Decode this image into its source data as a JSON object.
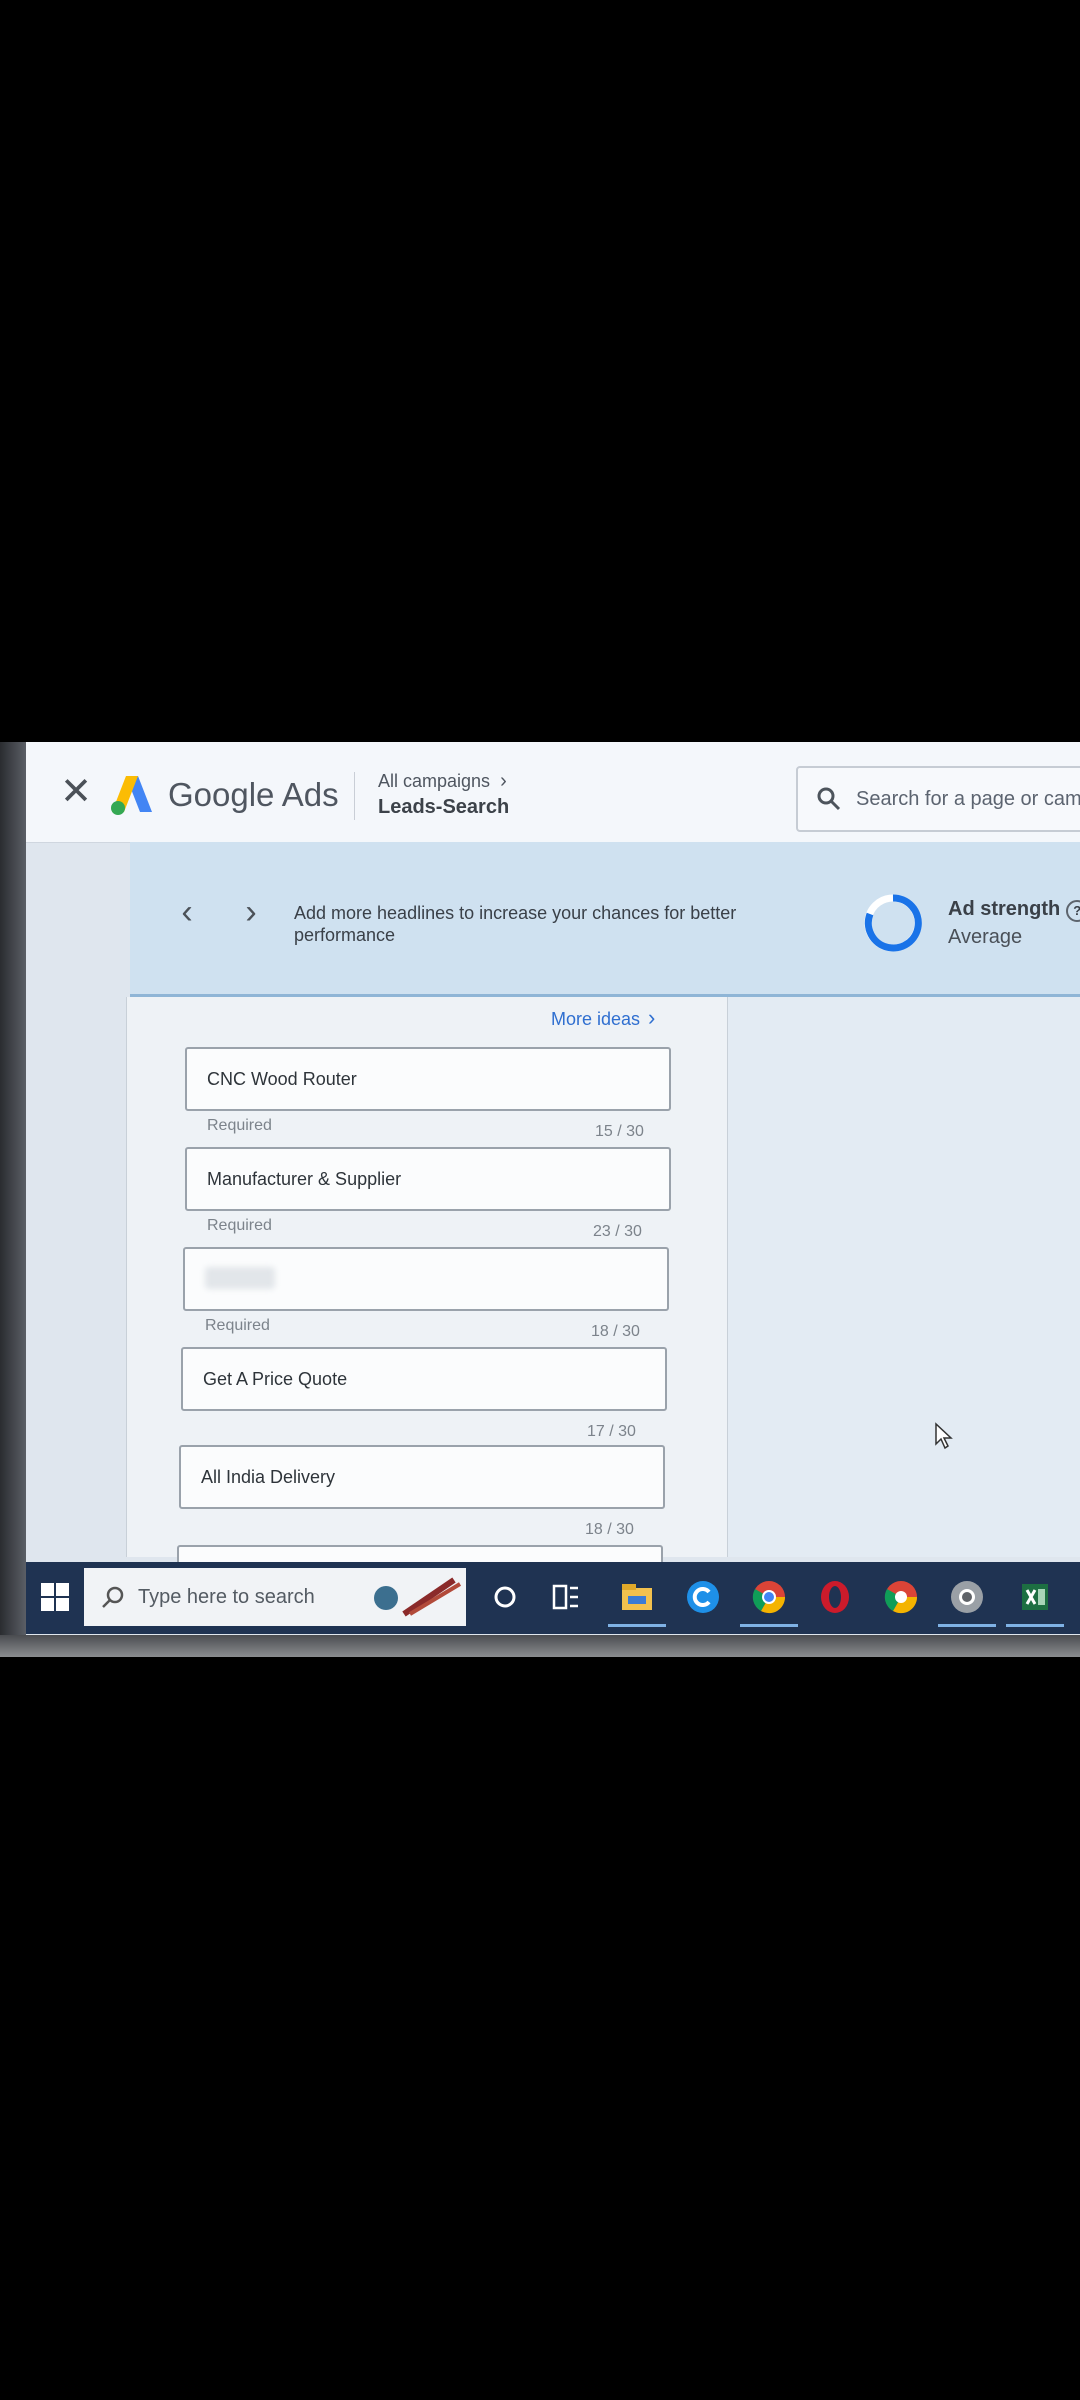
{
  "header": {
    "close_icon": "close-icon",
    "brand": "Google Ads",
    "breadcrumb_top": "All campaigns",
    "breadcrumb_main": "Leads-Search",
    "search_placeholder": "Search for a page or camp"
  },
  "banner": {
    "message": "Add more headlines to increase your chances for better performance",
    "strength_title": "Ad strength",
    "strength_value": "Average"
  },
  "content": {
    "more_ideas": "More ideas",
    "headlines": [
      {
        "value": "CNC Wood Router",
        "hint": "Required",
        "count": "15 / 30"
      },
      {
        "value": "Manufacturer & Supplier",
        "hint": "Required",
        "count": "23 / 30"
      },
      {
        "value": "",
        "hint": "Required",
        "count": "18 / 30"
      },
      {
        "value": "Get A Price Quote",
        "hint": "",
        "count": "17 / 30"
      },
      {
        "value": "All India Delivery",
        "hint": "",
        "count": "18 / 30"
      }
    ]
  },
  "taskbar": {
    "search_placeholder": "Type here to search"
  },
  "colors": {
    "accent": "#2f6fd0",
    "taskbar": "#1f3352",
    "banner": "#cfe1f0"
  }
}
